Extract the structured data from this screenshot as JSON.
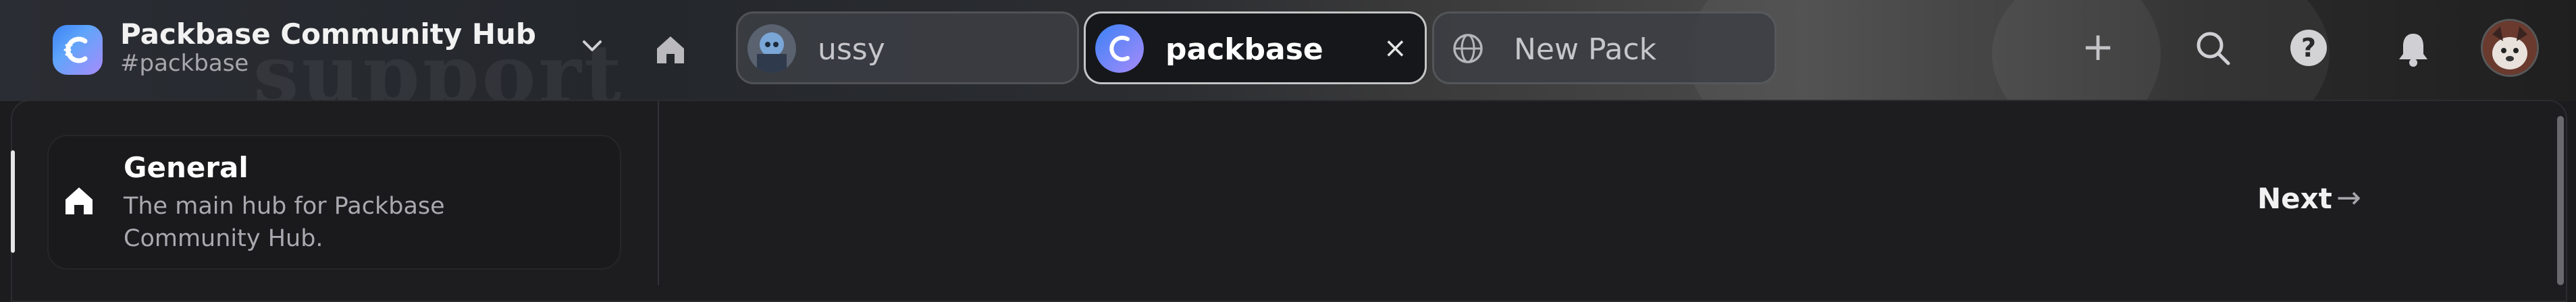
{
  "hub": {
    "title": "Packbase Community Hub",
    "handle": "#packbase",
    "background_text": "support"
  },
  "tabs": [
    {
      "label": "ussy",
      "active": false
    },
    {
      "label": "packbase",
      "active": true,
      "close": "×"
    },
    {
      "label": "New Pack",
      "active": false
    }
  ],
  "toolbar": {
    "plus": "+",
    "help": "?"
  },
  "channel": {
    "name": "General",
    "description": "The main hub for Packbase Community Hub."
  },
  "navigation": {
    "next_label": "Next",
    "next_arrow": "→"
  },
  "icons": [
    "logo-icon",
    "chevron-down-icon",
    "home-icon",
    "globe-icon",
    "close-icon",
    "plus-icon",
    "search-icon",
    "help-icon",
    "bell-icon",
    "avatar"
  ],
  "colors": {
    "accent_gradient_start": "#3b82f6",
    "accent_gradient_end": "#a78bfa",
    "panel_bg": "#1d1d20",
    "text_primary": "#ffffff",
    "text_secondary": "#a9a9af"
  }
}
